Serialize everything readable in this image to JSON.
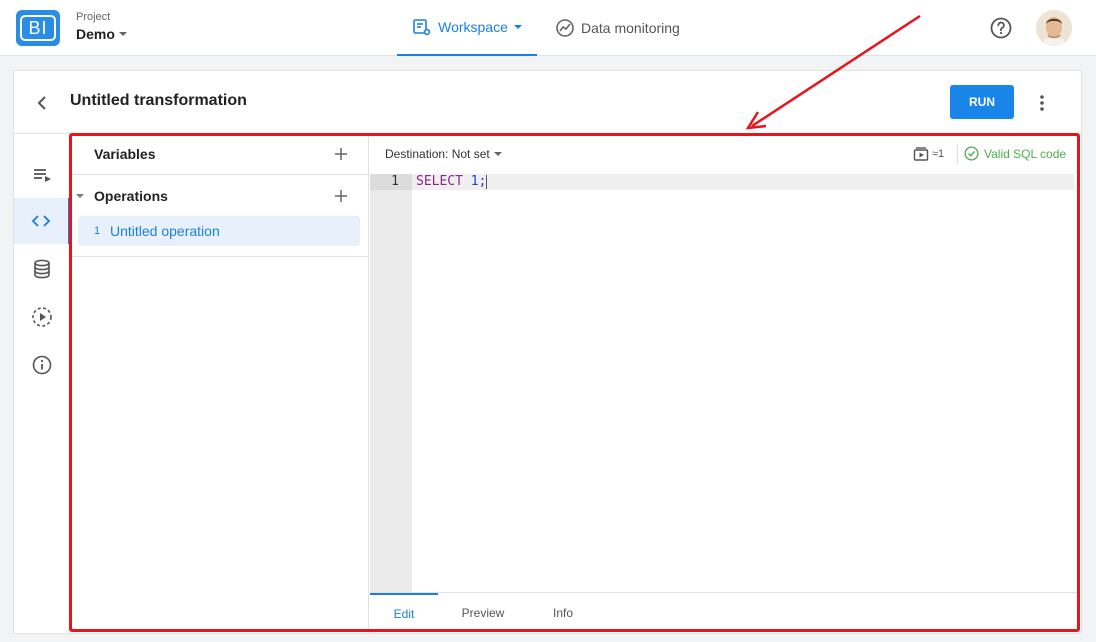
{
  "header": {
    "logo_text": "BI",
    "project_label": "Project",
    "project_name": "Demo",
    "nav": [
      {
        "label": "Workspace",
        "active": true
      },
      {
        "label": "Data monitoring",
        "active": false
      }
    ]
  },
  "page": {
    "title": "Untitled transformation",
    "run_label": "RUN"
  },
  "left_panel": {
    "variables_title": "Variables",
    "operations_title": "Operations",
    "operations": [
      {
        "num": "1",
        "name": "Untitled operation",
        "selected": true
      }
    ]
  },
  "editor": {
    "destination": "Destination: Not set",
    "stage_count": "≈1",
    "validity": "Valid SQL code",
    "line_number": "1",
    "code_keyword": "SELECT",
    "code_rest": "1;",
    "tabs": [
      {
        "label": "Edit",
        "active": true
      },
      {
        "label": "Preview",
        "active": false
      },
      {
        "label": "Info",
        "active": false
      }
    ]
  },
  "colors": {
    "accent": "#1a7fe0",
    "success": "#4cae4c",
    "annotation": "#e8141c"
  }
}
